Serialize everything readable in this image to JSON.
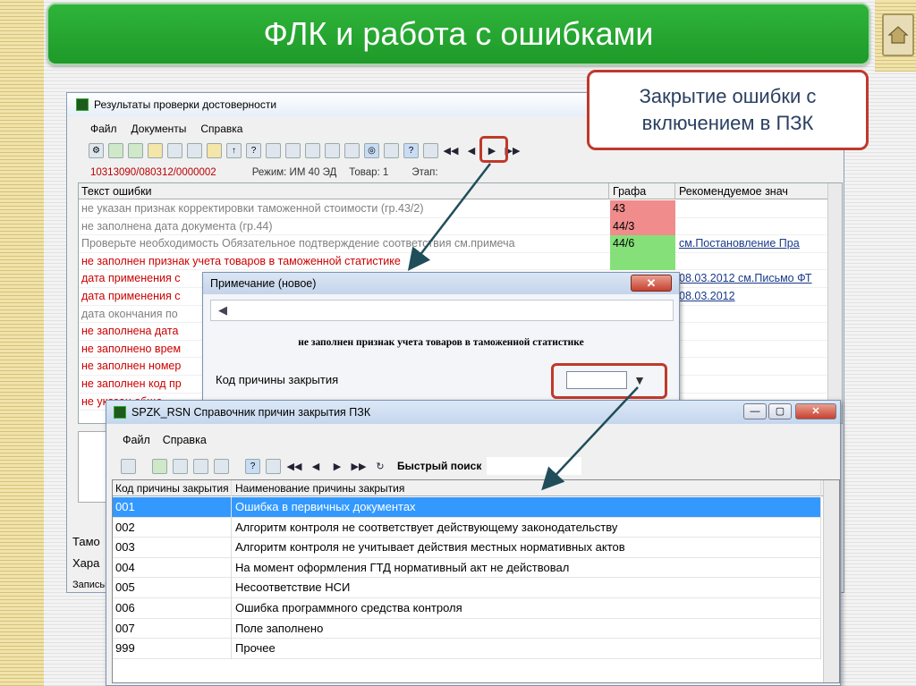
{
  "slide": {
    "title": "ФЛК и работа с ошибками",
    "callout": "Закрытие ошибки с включением в ПЗК"
  },
  "main_window": {
    "title": "Результаты проверки достоверности",
    "menu": [
      "Файл",
      "Документы",
      "Справка"
    ],
    "info": {
      "doc_number": "10313090/080312/0000002",
      "mode": "Режим: ИМ 40 ЭД",
      "item": "Товар: 1",
      "stage": "Этап:"
    },
    "columns": [
      "Текст ошибки",
      "Графа",
      "Рекомендуемое знач"
    ],
    "rows": [
      {
        "text": "не указан признак корректировки таможенной стоимости (гр.43/2)",
        "graf": "43",
        "rec": "",
        "kind": "gray",
        "graf_color": "#f08c8c"
      },
      {
        "text": "не заполнена дата документа (гр.44)",
        "graf": "44/3",
        "rec": "",
        "kind": "gray",
        "graf_color": "#f08c8c"
      },
      {
        "text": "Проверьте необходимость Обязательное подтверждение соответствия см.примеча",
        "graf": "44/6",
        "rec": "см.Постановление Пра",
        "kind": "gray",
        "graf_color": "#86e07a"
      },
      {
        "text": "не заполнен признак учета товаров в таможенной статистике",
        "graf": "",
        "rec": "",
        "kind": "red",
        "graf_color": "#86e07a"
      },
      {
        "text": "дата применения с",
        "graf": "",
        "rec": "08.03.2012 см.Письмо ФТ",
        "kind": "red",
        "graf_color": ""
      },
      {
        "text": "дата применения с",
        "graf": "",
        "rec": "08.03.2012",
        "kind": "red",
        "graf_color": ""
      },
      {
        "text": "дата окончания по",
        "graf": "",
        "rec": "",
        "kind": "gray",
        "graf_color": ""
      },
      {
        "text": "не заполнена дата",
        "graf": "",
        "rec": "",
        "kind": "red",
        "graf_color": ""
      },
      {
        "text": "не заполнено врем",
        "graf": "",
        "rec": "",
        "kind": "red",
        "graf_color": ""
      },
      {
        "text": "не заполнен номер",
        "graf": "",
        "rec": "",
        "kind": "red",
        "graf_color": ""
      },
      {
        "text": "не заполнен код пр",
        "graf": "",
        "rec": "",
        "kind": "red",
        "graf_color": ""
      },
      {
        "text": "не указан обще",
        "graf": "",
        "rec": "",
        "kind": "red",
        "graf_color": ""
      }
    ],
    "side_labels": [
      "Тамо",
      "Хара"
    ],
    "status": "Записьь"
  },
  "note_dialog": {
    "title": "Примечание (новое)",
    "message": "не заполнен признак учета товаров в таможенной статистике",
    "code_label": "Код причины закрытия",
    "code_value": ""
  },
  "ref_window": {
    "title": "SPZK_RSN Справочник причин закрытия ПЗК",
    "menu": [
      "Файл",
      "Справка"
    ],
    "search_label": "Быстрый поиск",
    "search_value": "",
    "columns": [
      "Код причины закрытия",
      "Наименование причины закрытия"
    ],
    "rows": [
      {
        "code": "001",
        "name": "Ошибка в первичных документах"
      },
      {
        "code": "002",
        "name": "Алгоритм контроля не соответствует действующему законодательству"
      },
      {
        "code": "003",
        "name": "Алгоритм контроля не учитывает действия местных нормативных актов"
      },
      {
        "code": "004",
        "name": "На момент оформления ГТД нормативный акт не действовал"
      },
      {
        "code": "005",
        "name": "Несоответствие НСИ"
      },
      {
        "code": "006",
        "name": "Ошибка программного средства контроля"
      },
      {
        "code": "007",
        "name": "Поле заполнено"
      },
      {
        "code": "999",
        "name": "Прочее"
      }
    ],
    "selected_index": 0
  },
  "colors": {
    "title_green": "#1e9a29",
    "highlight_red": "#c0392b",
    "error_red": "#cc0000",
    "selection_blue": "#3399ff"
  }
}
